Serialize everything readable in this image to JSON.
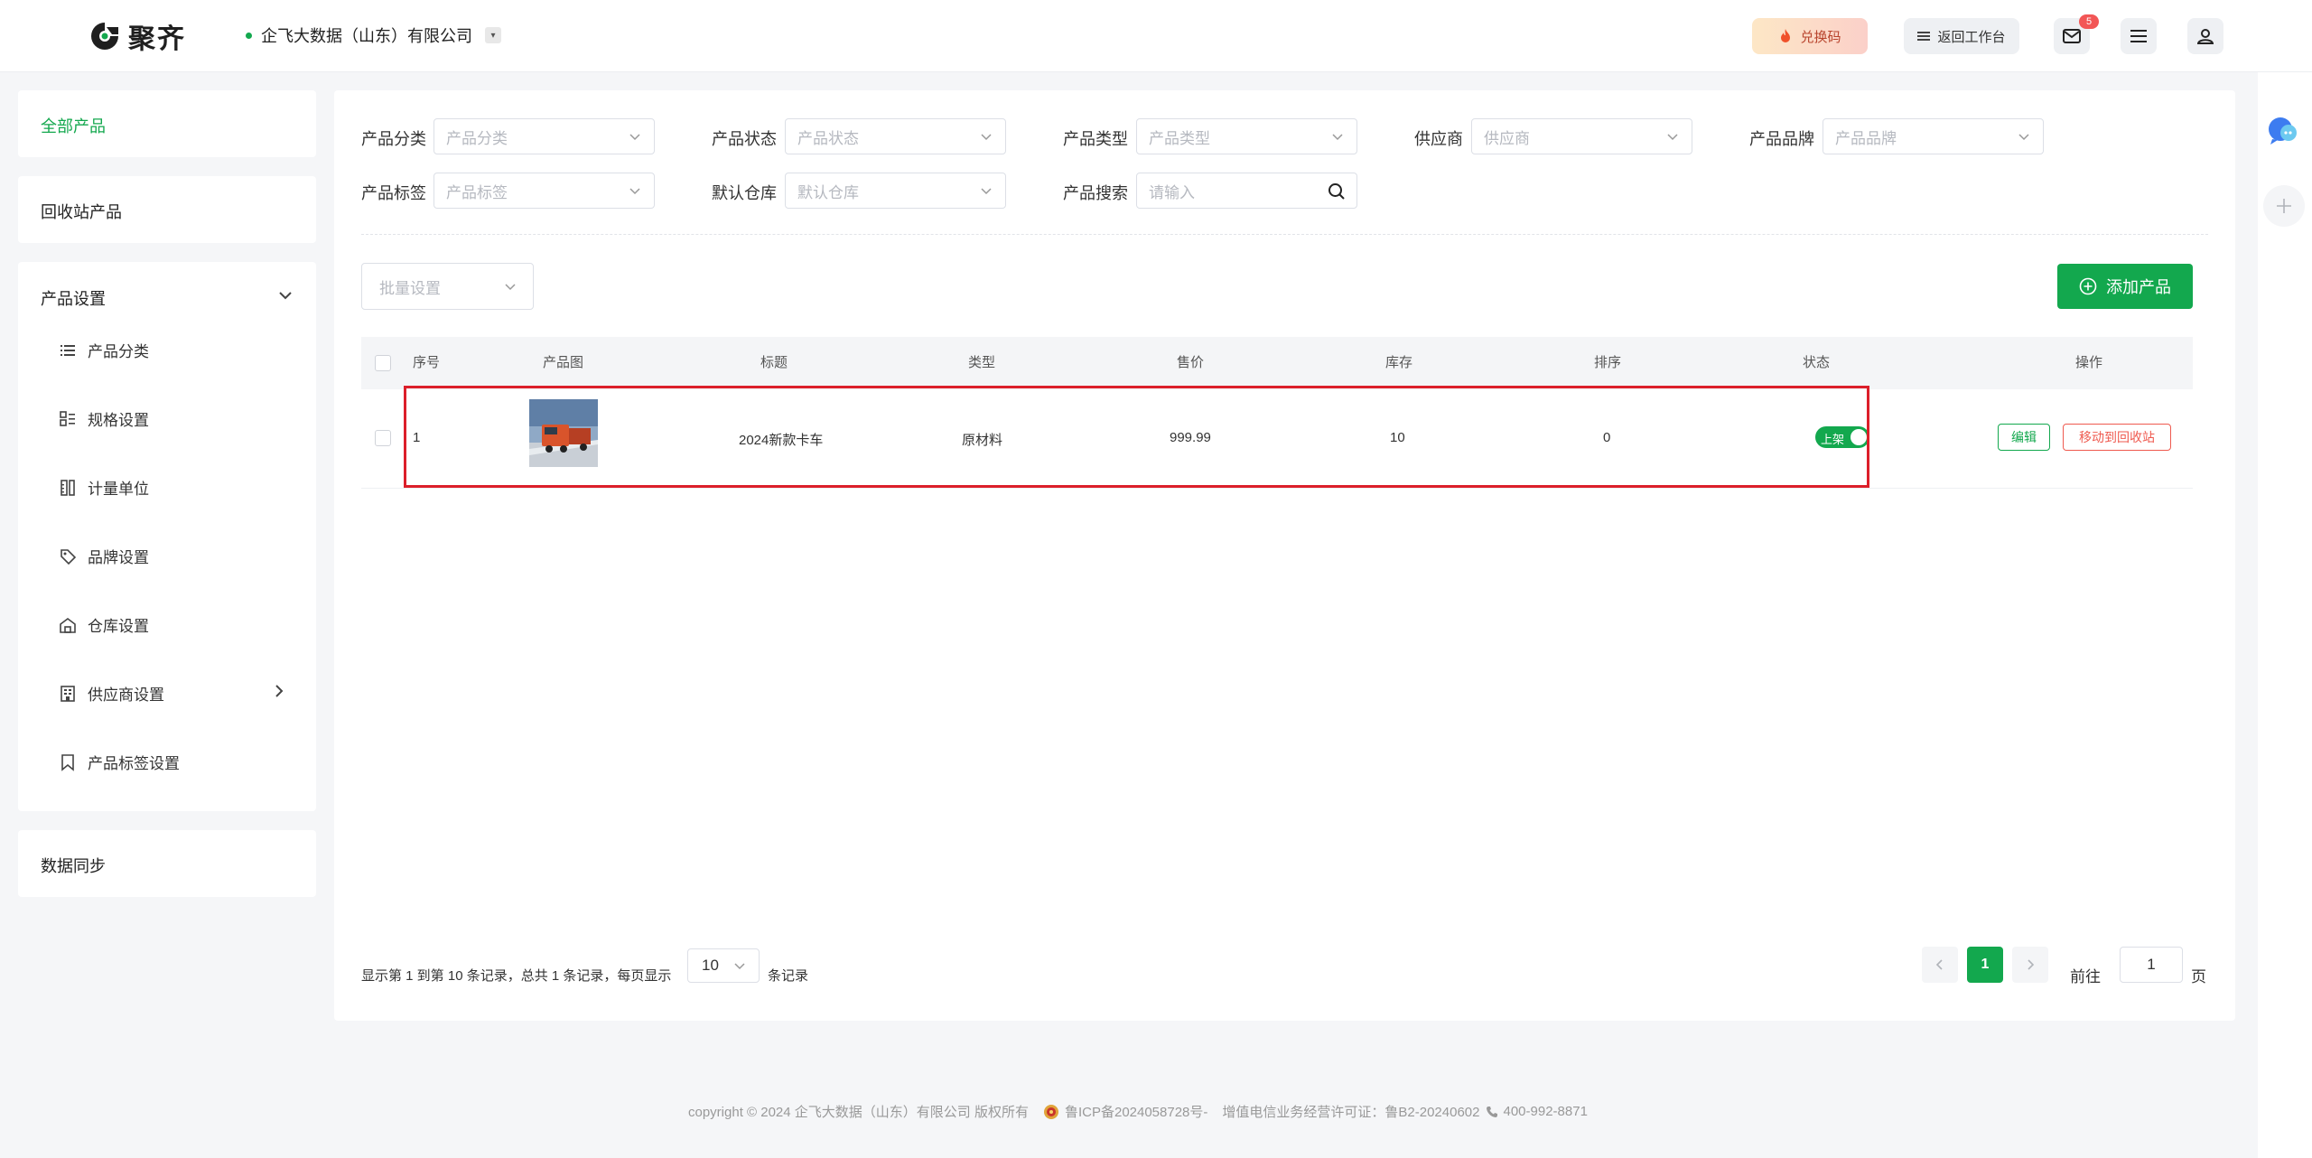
{
  "header": {
    "logo_text": "聚齐",
    "company": "企飞大数据（山东）有限公司",
    "redeem_label": "兑换码",
    "back_label": "返回工作台",
    "message_count": "5"
  },
  "sidebar": {
    "all_products": "全部产品",
    "recycle": "回收站产品",
    "settings_group": "产品设置",
    "settings_items": [
      {
        "label": "产品分类",
        "icon": "list-icon"
      },
      {
        "label": "规格设置",
        "icon": "spec-icon"
      },
      {
        "label": "计量单位",
        "icon": "ruler-icon"
      },
      {
        "label": "品牌设置",
        "icon": "tag-icon"
      },
      {
        "label": "仓库设置",
        "icon": "warehouse-icon"
      },
      {
        "label": "供应商设置",
        "icon": "building-icon"
      },
      {
        "label": "产品标签设置",
        "icon": "bookmark-icon"
      }
    ],
    "data_sync": "数据同步"
  },
  "filters": {
    "category": {
      "label": "产品分类",
      "placeholder": "产品分类"
    },
    "status": {
      "label": "产品状态",
      "placeholder": "产品状态"
    },
    "type": {
      "label": "产品类型",
      "placeholder": "产品类型"
    },
    "supplier": {
      "label": "供应商",
      "placeholder": "供应商"
    },
    "brand": {
      "label": "产品品牌",
      "placeholder": "产品品牌"
    },
    "tag": {
      "label": "产品标签",
      "placeholder": "产品标签"
    },
    "warehouse": {
      "label": "默认仓库",
      "placeholder": "默认仓库"
    },
    "search": {
      "label": "产品搜索",
      "placeholder": "请输入"
    }
  },
  "toolbar": {
    "batch_placeholder": "批量设置",
    "add_label": "添加产品"
  },
  "table": {
    "headers": [
      "序号",
      "产品图",
      "标题",
      "类型",
      "售价",
      "库存",
      "排序",
      "状态",
      "操作"
    ],
    "rows": [
      {
        "index": "1",
        "title": "2024新款卡车",
        "type": "原材料",
        "price": "999.99",
        "stock": "10",
        "sort": "0",
        "status_label": "上架",
        "edit_label": "编辑",
        "recycle_label": "移动到回收站"
      }
    ]
  },
  "pagination": {
    "summary": "显示第 1 到第 10 条记录，总共 1 条记录，每页显示",
    "page_size": "10",
    "suffix": "条记录",
    "current_page": "1",
    "goto_label": "前往",
    "goto_value": "1",
    "page_unit": "页"
  },
  "footer": {
    "copyright": "copyright © 2024 企飞大数据（山东）有限公司 版权所有",
    "icp": "鲁ICP备2024058728号-",
    "license": "增值电信业务经营许可证：鲁B2-20240602",
    "phone": "400-992-8871"
  },
  "colors": {
    "accent": "#13a84e",
    "danger": "#ef5a4f",
    "highlight": "#dc1f2a"
  }
}
